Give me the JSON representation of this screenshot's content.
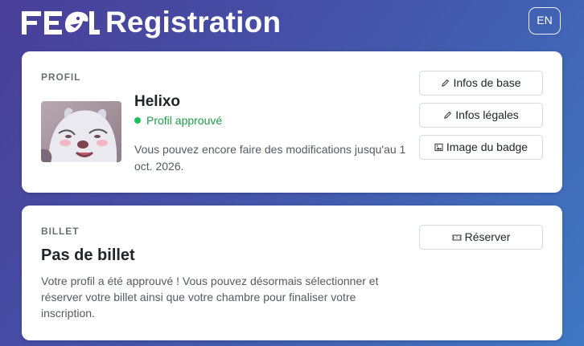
{
  "header": {
    "logo_text": "FEL",
    "title": "Registration",
    "language_button": "EN"
  },
  "profile": {
    "section_label": "PROFIL",
    "name": "Helixo",
    "status": "Profil approuvé",
    "status_color": "#1e9e4a",
    "description": "Vous pouvez encore faire des modifications jusqu'au 1 oct. 2026.",
    "avatar_icon": "character-avatar-image",
    "buttons": [
      {
        "label": "Infos de base",
        "icon": "pencil-icon"
      },
      {
        "label": "Infos légales",
        "icon": "pencil-icon"
      },
      {
        "label": "Image du badge",
        "icon": "image-icon"
      }
    ]
  },
  "ticket": {
    "section_label": "BILLET",
    "title": "Pas de billet",
    "description": "Votre profil a été approuvé ! Vous pouvez désormais sélectionner et réserver votre billet ainsi que votre chambre pour finaliser votre inscription.",
    "button": {
      "label": "Réserver",
      "icon": "ticket-icon"
    }
  },
  "colors": {
    "background_start": "#4a3f9a",
    "background_end": "#3f78c2",
    "card": "#ffffff",
    "status_dot": "#22c05a"
  }
}
